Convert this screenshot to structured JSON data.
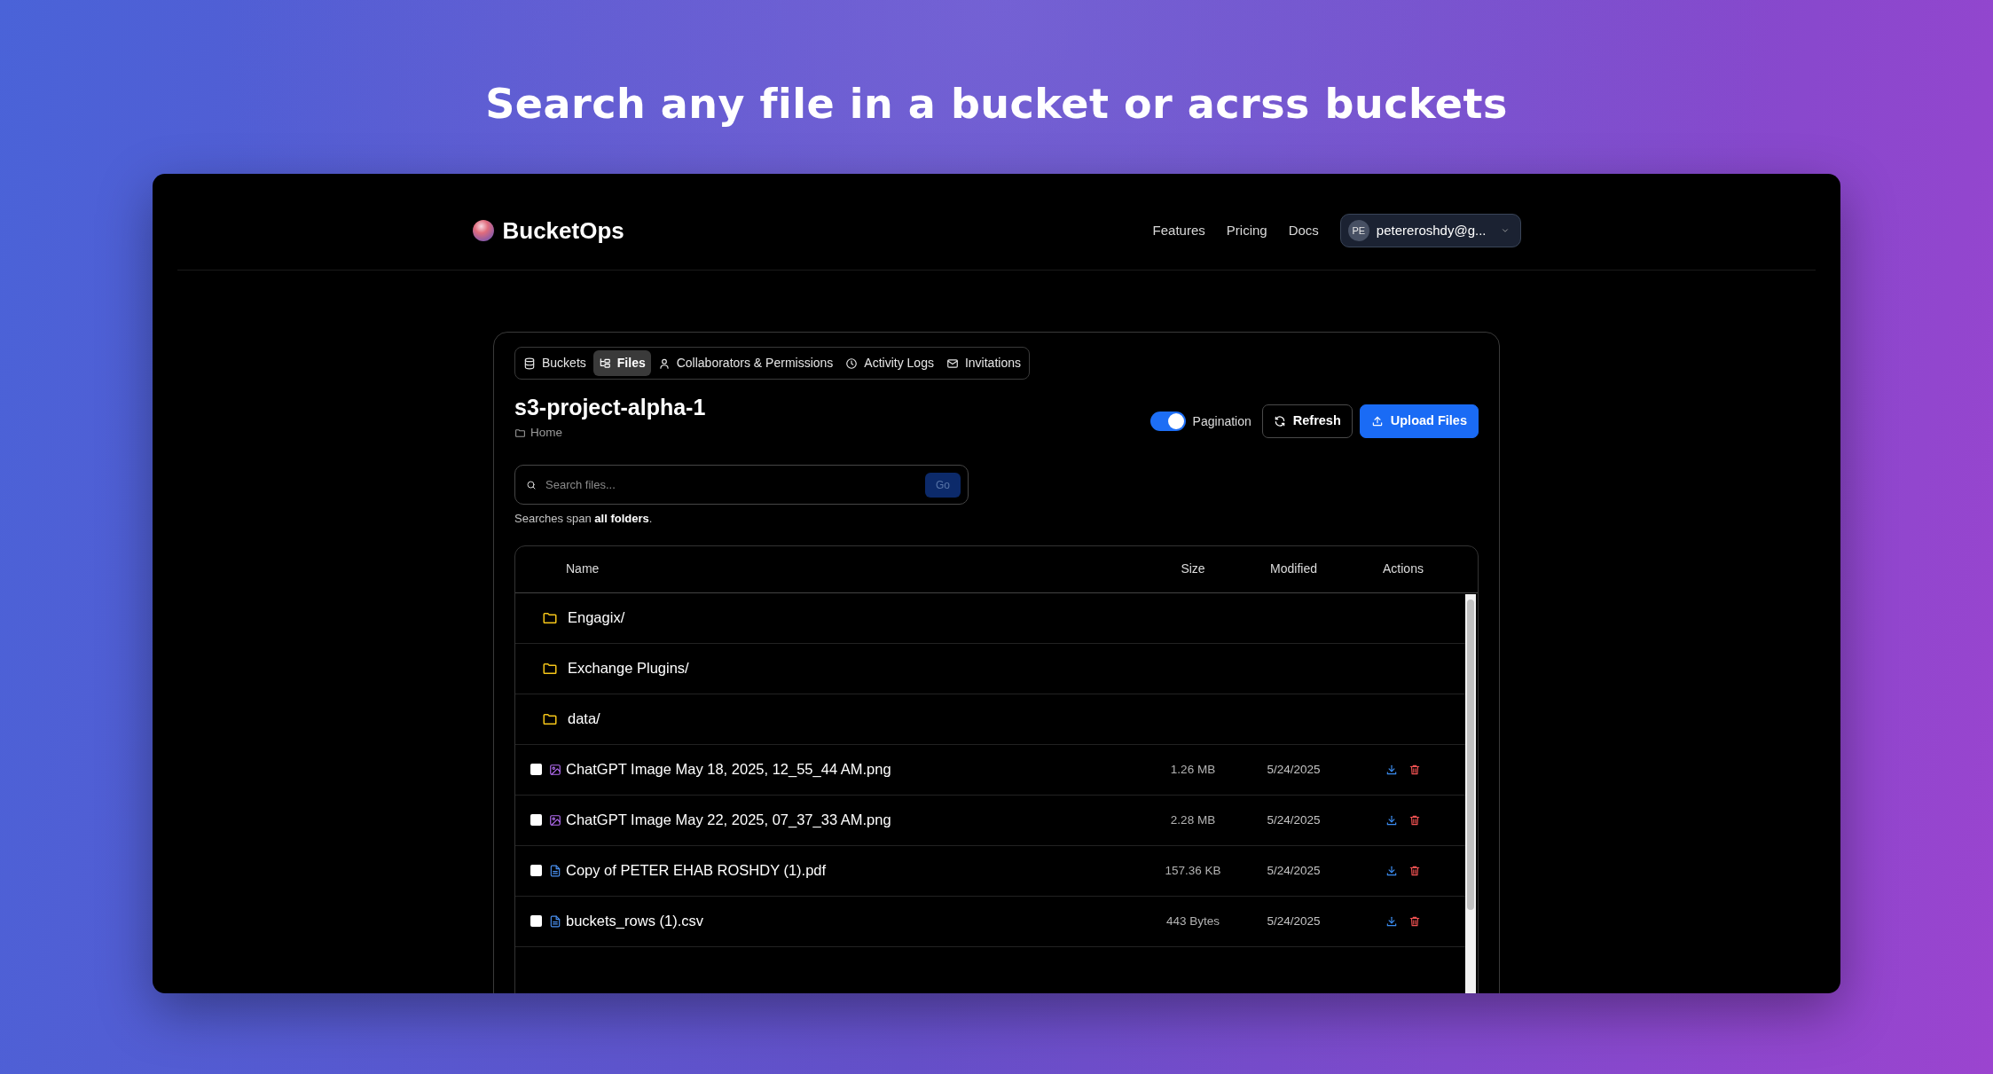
{
  "headline": "Search any file in a bucket or acrss buckets",
  "brand": "BucketOps",
  "nav_links": [
    "Features",
    "Pricing",
    "Docs"
  ],
  "account": {
    "initials": "PE",
    "email": "petereroshdy@g..."
  },
  "tabs": [
    {
      "label": "Buckets",
      "selected": false
    },
    {
      "label": "Files",
      "selected": true
    },
    {
      "label": "Collaborators & Permissions",
      "selected": false
    },
    {
      "label": "Activity Logs",
      "selected": false
    },
    {
      "label": "Invitations",
      "selected": false
    }
  ],
  "bucket": {
    "title": "s3-project-alpha-1",
    "breadcrumb": "Home"
  },
  "pagination": {
    "label": "Pagination",
    "on": true
  },
  "buttons": [
    {
      "kind": "outline",
      "label": "Refresh"
    },
    {
      "kind": "primary",
      "label": "Upload Files"
    }
  ],
  "search": {
    "placeholder": "Search files...",
    "button": "Go",
    "hint": "Searches span **all folders**."
  },
  "table": {
    "columns": [
      "Name",
      "Size",
      "Modified",
      "Actions"
    ],
    "rows": [
      {
        "kind": "folder",
        "name": "Engagix/"
      },
      {
        "kind": "folder",
        "name": "Exchange Plugins/"
      },
      {
        "kind": "folder",
        "name": "data/"
      },
      {
        "kind": "image",
        "name": "ChatGPT Image May 18, 2025, 12_55_44 AM.png",
        "size": "1.26 MB",
        "modified": "5/24/2025",
        "checked": false
      },
      {
        "kind": "image",
        "name": "ChatGPT Image May 22, 2025, 07_37_33 AM.png",
        "size": "2.28 MB",
        "modified": "5/24/2025",
        "checked": false
      },
      {
        "kind": "document",
        "name": "Copy of PETER EHAB ROSHDY (1).pdf",
        "size": "157.36 KB",
        "modified": "5/24/2025",
        "checked": false
      },
      {
        "kind": "document",
        "name": "buckets_rows (1).csv",
        "size": "443 Bytes",
        "modified": "5/24/2025",
        "checked": false
      }
    ]
  }
}
